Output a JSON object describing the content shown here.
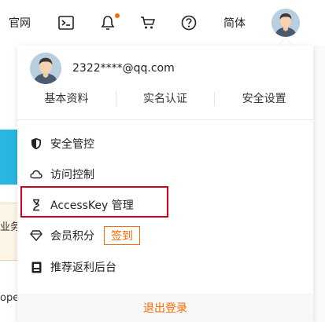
{
  "topbar": {
    "home_label": "官网",
    "lang_label": "简体",
    "icons": [
      "terminal-icon",
      "bell-icon",
      "cart-icon",
      "help-icon"
    ]
  },
  "user": {
    "email": "2322****@qq.com"
  },
  "account_links": [
    "基本资料",
    "实名认证",
    "安全设置"
  ],
  "menu": [
    {
      "label": "安全管控",
      "icon": "shield-icon"
    },
    {
      "label": "访问控制",
      "icon": "cloud-icon"
    },
    {
      "label": "AccessKey 管理",
      "icon": "key-icon",
      "highlighted": true
    },
    {
      "label": "会员积分",
      "icon": "diamond-icon",
      "action": "签到"
    },
    {
      "label": "推荐返利后台",
      "icon": "referral-icon"
    }
  ],
  "logout_label": "退出登录",
  "background": {
    "fragment_1": "业务",
    "fragment_2": "ope"
  },
  "colors": {
    "accent": "#ff6a00",
    "highlight_border": "#d0021b",
    "stripe": "#29b6e0"
  }
}
